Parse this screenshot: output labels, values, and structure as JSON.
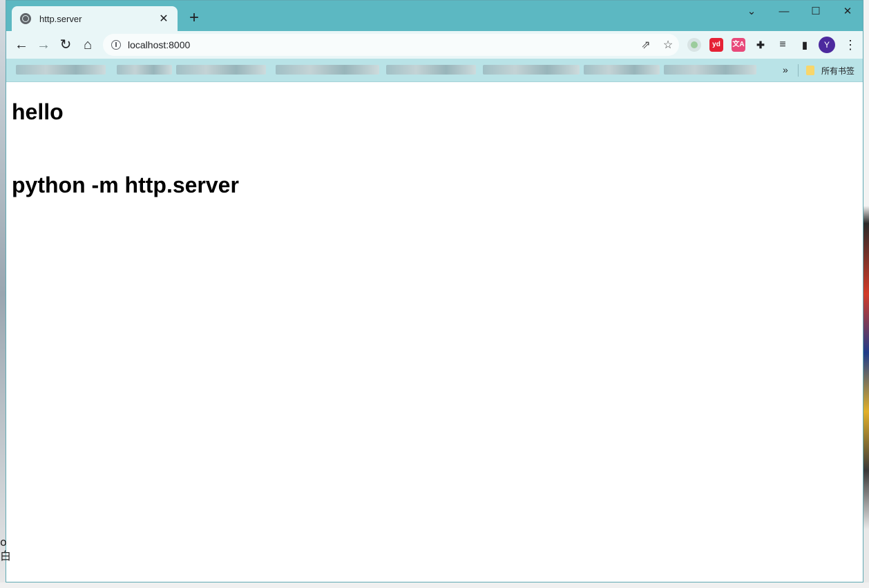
{
  "browser": {
    "tab": {
      "title": "http.server",
      "close_glyph": "✕",
      "icon": "globe-icon"
    },
    "new_tab_glyph": "+",
    "window_controls": [
      "⌄",
      "—",
      "☐",
      "✕"
    ],
    "toolbar": {
      "back_glyph": "←",
      "forward_glyph": "→",
      "reload_glyph": "↻",
      "home_glyph": "⌂",
      "url": "localhost:8000",
      "share_glyph": "⇗",
      "star_glyph": "☆",
      "extensions": [
        {
          "name": "circle-extension-icon",
          "label": "",
          "color": "#9ccc9c"
        },
        {
          "name": "youdao-extension-icon",
          "label": "yd",
          "color": "#e52235"
        },
        {
          "name": "translate-extension-icon",
          "label": "文A",
          "color": "#e8497a"
        },
        {
          "name": "puzzle-extension-icon",
          "label": "✚",
          "color": "#202124"
        },
        {
          "name": "reading-list-icon",
          "label": "≡",
          "color": "#202124"
        },
        {
          "name": "side-panel-icon",
          "label": "▮",
          "color": "#202124"
        }
      ],
      "avatar_letter": "Y",
      "menu_glyph": "⋮"
    },
    "bookmarks": {
      "more_glyph": "»",
      "all_bookmarks_label": "所有书签"
    }
  },
  "page": {
    "heading1": "hello",
    "heading2": "python -m http.server"
  },
  "desktop": {
    "peek_text": "o\n白"
  }
}
